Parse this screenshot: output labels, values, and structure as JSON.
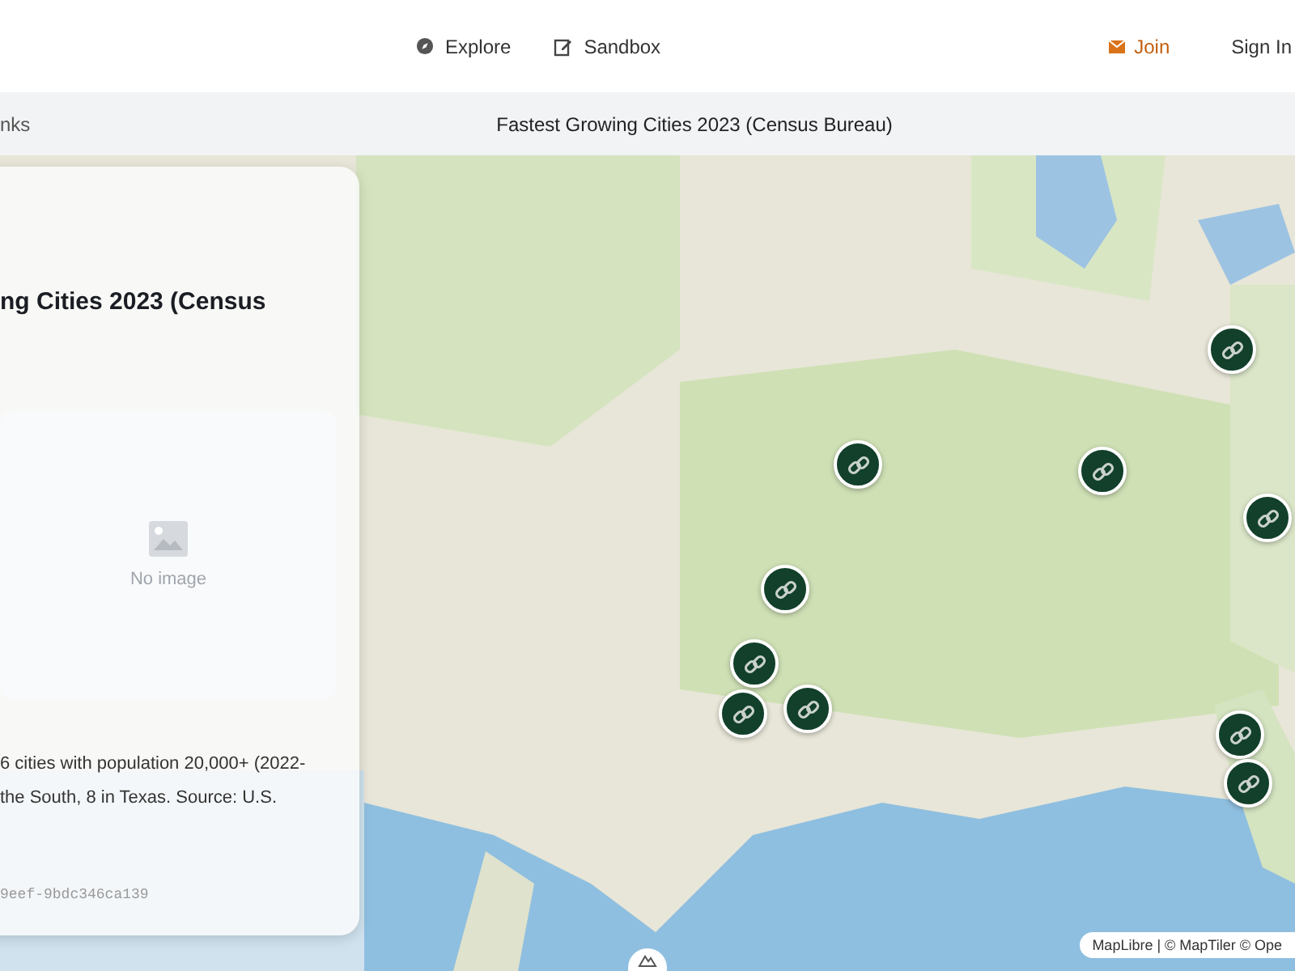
{
  "nav": {
    "links": [
      {
        "label": "Explore",
        "kind": "explore"
      },
      {
        "label": "Sandbox",
        "kind": "sandbox"
      }
    ],
    "join": "Join",
    "sign_in": "Sign In"
  },
  "subbar": {
    "left": "nks",
    "title": "Fastest Growing Cities 2023 (Census Bureau)"
  },
  "panel": {
    "heading": "ng Cities 2023 (Census",
    "image_placeholder": "No image",
    "description": "6 cities with population 20,000+ (2022- the South, 8 in Texas. Source: U.S.",
    "id": "9eef-9bdc346ca139"
  },
  "map": {
    "kind": "picture",
    "attribution": "MapLibre | © MapTiler © Ope"
  },
  "markers": [
    {
      "kind": "link"
    },
    {
      "kind": "link"
    },
    {
      "kind": "link"
    },
    {
      "kind": "link"
    },
    {
      "kind": "link"
    },
    {
      "kind": "link"
    },
    {
      "kind": "link"
    },
    {
      "kind": "link"
    },
    {
      "kind": "link"
    },
    {
      "kind": "link"
    }
  ]
}
